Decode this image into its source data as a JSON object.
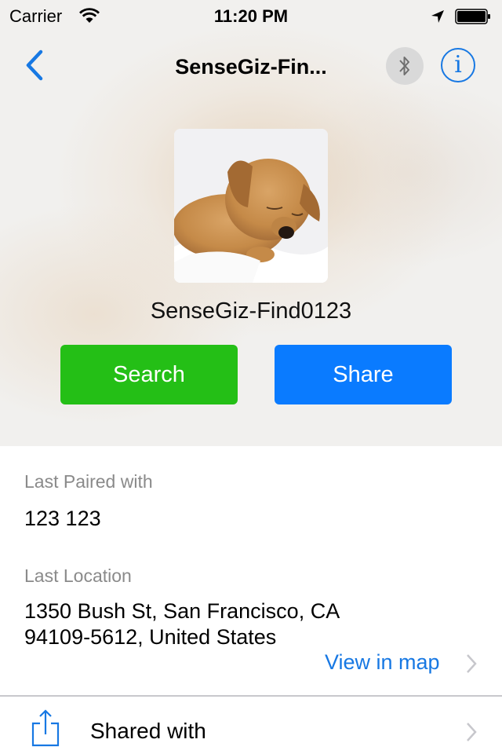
{
  "status_bar": {
    "carrier": "Carrier",
    "time": "11:20 PM",
    "icons": [
      "wifi-icon",
      "location-arrow-icon",
      "battery-icon"
    ]
  },
  "nav": {
    "back_icon": "chevron-left-icon",
    "title": "SenseGiz-Fin...",
    "bluetooth_icon": "bluetooth-icon",
    "info_icon": "info-icon",
    "info_glyph": "i"
  },
  "device": {
    "avatar": "sleeping puppy photo",
    "name": "SenseGiz-Find0123"
  },
  "actions": {
    "search_label": "Search",
    "share_label": "Share"
  },
  "details": {
    "last_paired_label": "Last Paired with",
    "last_paired_value": "123 123",
    "last_location_label": "Last Location",
    "address_line1": "1350 Bush St, San Francisco, CA",
    "address_line2": "94109-5612, United States",
    "view_in_map_label": "View in map"
  },
  "shared": {
    "icon": "share-icon",
    "label": "Shared with"
  },
  "colors": {
    "accent_blue": "#1778e3",
    "search_green": "#24bf16",
    "share_blue": "#0a7bff",
    "label_gray": "#8a8a8a"
  }
}
